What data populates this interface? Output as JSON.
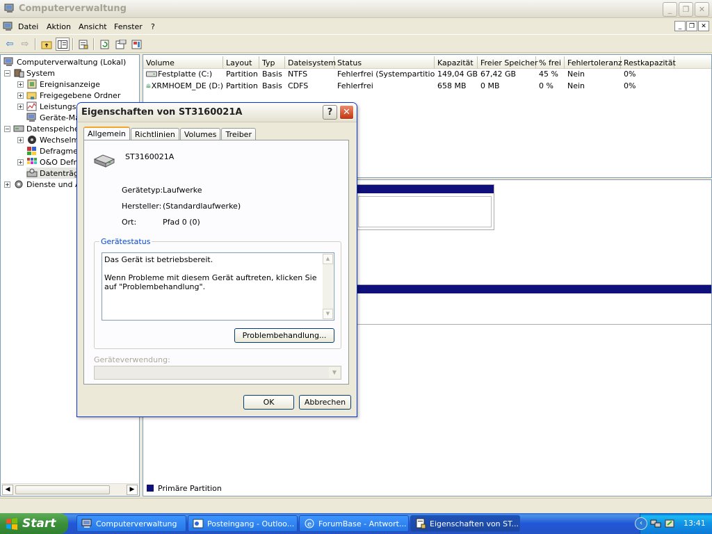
{
  "app": {
    "title": "Computerverwaltung",
    "menu": [
      "Datei",
      "Aktion",
      "Ansicht",
      "Fenster",
      "?"
    ]
  },
  "tree": {
    "root": "Computerverwaltung (Lokal)",
    "items": [
      {
        "label": "System",
        "exp": "−"
      },
      {
        "label": "Ereignisanzeige",
        "exp": "+"
      },
      {
        "label": "Freigegebene Ordner",
        "exp": "+"
      },
      {
        "label": "Leistungsp",
        "exp": "+"
      },
      {
        "label": "Geräte-Ma",
        "exp": ""
      },
      {
        "label": "Datenspeicher",
        "exp": "−"
      },
      {
        "label": "Wechselme",
        "exp": "+"
      },
      {
        "label": "Defragmen",
        "exp": ""
      },
      {
        "label": "O&O Defra",
        "exp": "+"
      },
      {
        "label": "Datenträg",
        "exp": ""
      },
      {
        "label": "Dienste und A",
        "exp": "+"
      }
    ]
  },
  "volumes": {
    "columns": [
      "Volume",
      "Layout",
      "Typ",
      "Dateisystem",
      "Status",
      "Kapazität",
      "Freier Speicher",
      "% frei",
      "Fehlertoleranz",
      "Restkapazität"
    ],
    "rows": [
      [
        "Festplatte (C:)",
        "Partition",
        "Basis",
        "NTFS",
        "Fehlerfrei (Systempartition)",
        "149,04 GB",
        "67,42 GB",
        "45 %",
        "Nein",
        "0%"
      ],
      [
        "XRMHOEM_DE (D:)",
        "Partition",
        "Basis",
        "CDFS",
        "Fehlerfrei",
        "658 MB",
        "0 MB",
        "0 %",
        "Nein",
        "0%"
      ]
    ]
  },
  "legend": {
    "primary": "Primäre Partition"
  },
  "dialog": {
    "title": "Eigenschaften von ST3160021A",
    "help": "?",
    "close": "✕",
    "tabs": [
      "Allgemein",
      "Richtlinien",
      "Volumes",
      "Treiber"
    ],
    "device_name": "ST3160021A",
    "props": {
      "type_label": "Gerätetyp:",
      "type_value": "Laufwerke",
      "maker_label": "Hersteller:",
      "maker_value": "(Standardlaufwerke)",
      "loc_label": "Ort:",
      "loc_value": "Pfad 0 (0)"
    },
    "status_group": "Gerätestatus",
    "status_text": "Das Gerät ist betriebsbereit.\n\nWenn Probleme mit diesem Gerät auftreten, klicken Sie auf \"Problembehandlung\".",
    "troubleshoot": "Problembehandlung...",
    "usage_label": "Geräteverwendung:",
    "ok": "OK",
    "cancel": "Abbrechen"
  },
  "taskbar": {
    "start": "Start",
    "tasks": [
      "Computerverwaltung",
      "Posteingang - Outloo...",
      "ForumBase - Antwort...",
      "Eigenschaften von ST..."
    ],
    "clock": "13:41"
  }
}
